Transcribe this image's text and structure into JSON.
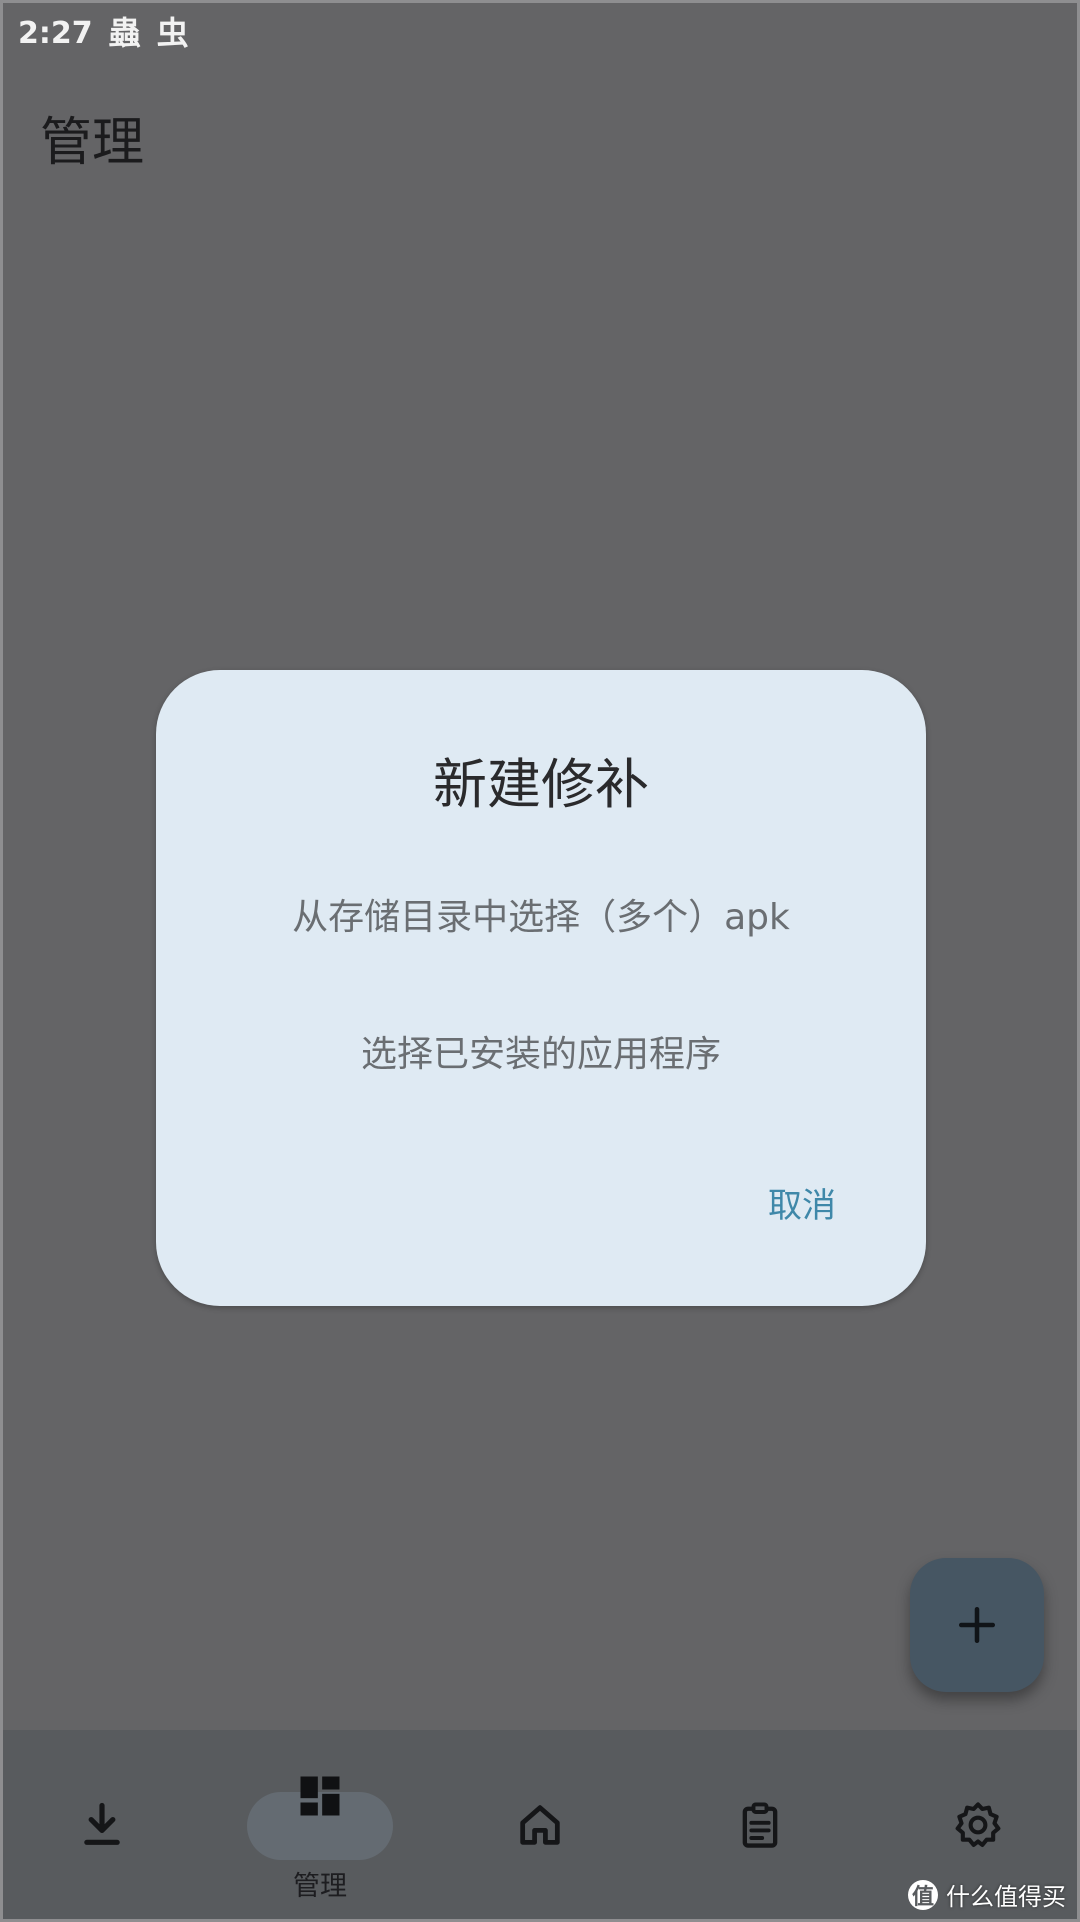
{
  "status_bar": {
    "time": "2:27",
    "icons": [
      "bug-icon",
      "bug-icon"
    ],
    "icon_glyphs": [
      "蟲",
      "虫"
    ]
  },
  "page": {
    "title": "管理"
  },
  "dialog": {
    "title": "新建修补",
    "options": [
      "从存储目录中选择（多个）apk",
      "选择已安装的应用程序"
    ],
    "cancel_label": "取消"
  },
  "fab": {
    "icon": "plus-icon"
  },
  "bottom_nav": {
    "active_index": 1,
    "items": [
      {
        "icon": "download-icon",
        "label": ""
      },
      {
        "icon": "dashboard-icon",
        "label": "管理"
      },
      {
        "icon": "home-icon",
        "label": ""
      },
      {
        "icon": "clipboard-icon",
        "label": ""
      },
      {
        "icon": "settings-icon",
        "label": ""
      }
    ]
  },
  "watermark": {
    "badge": "值",
    "text": "什么值得买"
  },
  "colors": {
    "scrim": "#646466",
    "dialog_bg": "#dfeaf3",
    "accent": "#3f88a9",
    "fab_bg": "#465663",
    "nav_bg": "#585b5e"
  }
}
